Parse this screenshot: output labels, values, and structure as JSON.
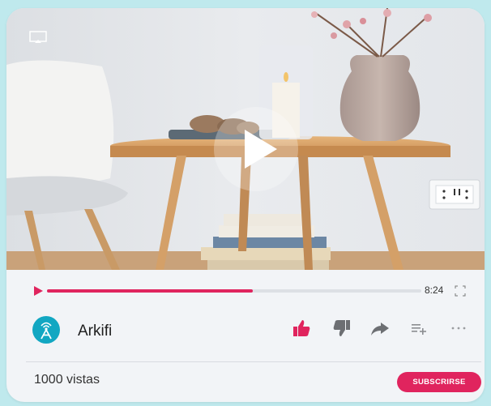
{
  "player": {
    "progress_fraction": 0.55,
    "duration": "8:24",
    "accent_color": "#e0245e",
    "icons": {
      "cast": "cast-icon",
      "play_overlay": "play-icon",
      "play_small": "play-icon",
      "fullscreen": "fullscreen-icon"
    }
  },
  "channel": {
    "name": "Arkifi",
    "avatar_icon": "antenna-icon",
    "avatar_color": "#12a7c2"
  },
  "actions": [
    {
      "name": "like-button",
      "icon": "thumbs-up-icon",
      "active": true
    },
    {
      "name": "dislike-button",
      "icon": "thumbs-down-icon",
      "active": false
    },
    {
      "name": "share-button",
      "icon": "share-icon",
      "active": false
    },
    {
      "name": "add-to-playlist-button",
      "icon": "playlist-add-icon",
      "active": false
    },
    {
      "name": "more-button",
      "icon": "more-horizontal-icon",
      "active": false
    }
  ],
  "stats": {
    "views": "1000 vistas"
  },
  "subscribe": {
    "label": "SUBSCRIRSE"
  }
}
